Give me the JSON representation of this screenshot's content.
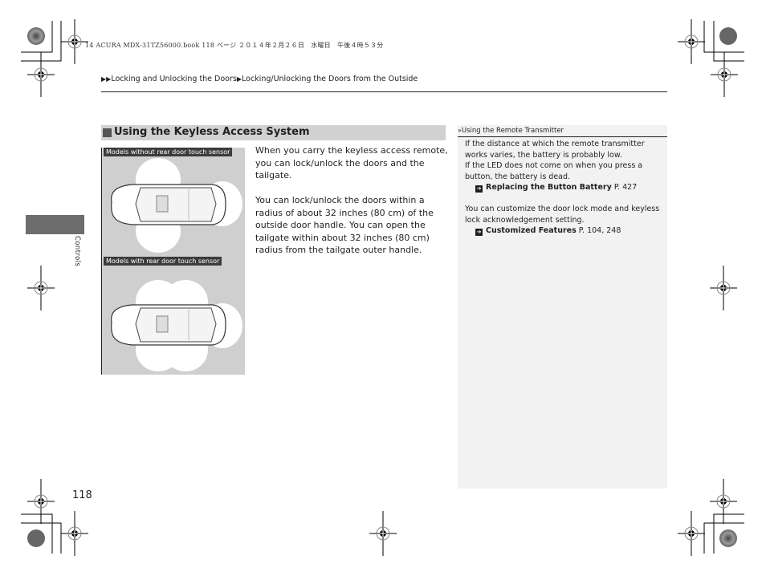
{
  "print_meta": {
    "text": "14 ACURA MDX-31TZ56000.book  118 ページ  ２０１４年２月２６日　水曜日　午後４時５３分"
  },
  "breadcrumb": {
    "level1": "Locking and Unlocking the Doors",
    "level2": "Locking/Unlocking the Doors from the Outside",
    "separator_icon": "triangle-right-icon"
  },
  "side_tab": {
    "label": "Controls"
  },
  "section": {
    "title": "Using the Keyless Access System",
    "figure": {
      "label_top": "Models without rear door touch sensor",
      "label_bottom": "Models with rear door touch sensor"
    },
    "paragraphs": [
      "When you carry the keyless access remote, you can lock/unlock the doors and the tailgate.",
      "You can lock/unlock the doors within a radius of about 32 inches (80 cm) of the outside door handle. You can open the tailgate within about 32 inches (80 cm) radius from the tailgate outer handle."
    ]
  },
  "sidebar": {
    "heading": "Using the Remote Transmitter",
    "heading_icon": "double-chevron-icon",
    "para1a": "If the distance at which the remote transmitter works varies, the battery is probably low.",
    "para1b": "If the LED does not come on when you press a button, the battery is dead.",
    "ref1": {
      "icon": "arrow-ref-icon",
      "title": "Replacing the Button Battery",
      "page": "P. 427"
    },
    "para2": "You can customize the door lock mode and keyless lock acknowledgement setting.",
    "ref2": {
      "icon": "arrow-ref-icon",
      "title": "Customized Features",
      "page": "P. 104, 248"
    }
  },
  "page_number": "118"
}
